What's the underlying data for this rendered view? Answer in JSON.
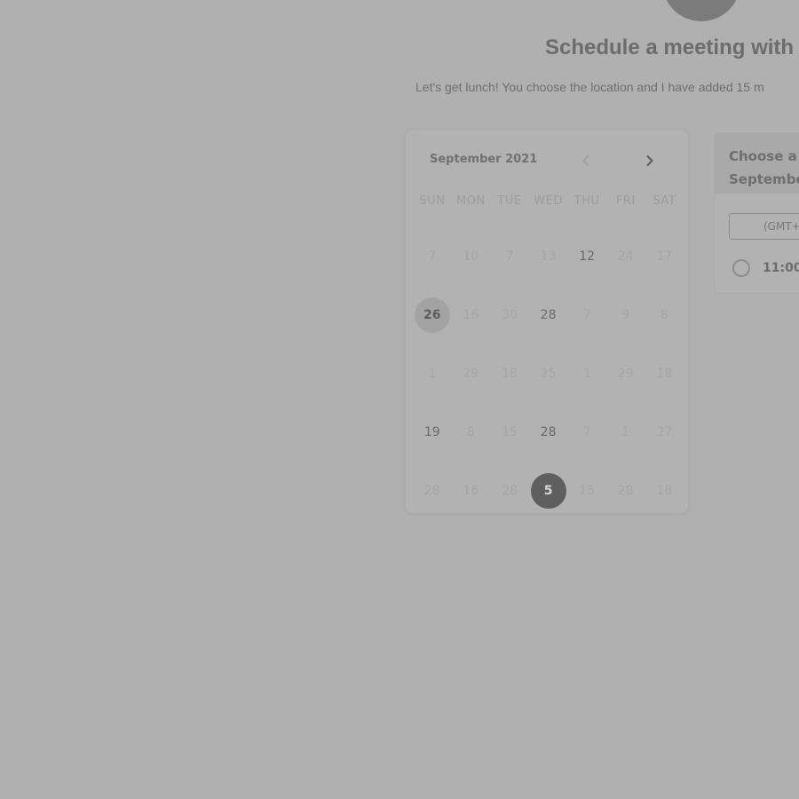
{
  "header": {
    "title": "Schedule a meeting with",
    "subtitle": "Let's get lunch! You choose the location and I have added 15 m"
  },
  "calendar": {
    "month_label": "September 2021",
    "prev_icon": "chevron-left-icon",
    "next_icon": "chevron-right-icon",
    "weekdays": [
      "SUN",
      "MON",
      "TUE",
      "WED",
      "THU",
      "FRI",
      "SAT"
    ],
    "weeks": [
      [
        {
          "label": "7",
          "state": "disabled"
        },
        {
          "label": "10",
          "state": "disabled"
        },
        {
          "label": "7",
          "state": "disabled"
        },
        {
          "label": "13",
          "state": "disabled"
        },
        {
          "label": "12",
          "state": "available"
        },
        {
          "label": "24",
          "state": "disabled"
        },
        {
          "label": "17",
          "state": "disabled"
        }
      ],
      [
        {
          "label": "26",
          "state": "today"
        },
        {
          "label": "16",
          "state": "disabled"
        },
        {
          "label": "30",
          "state": "disabled"
        },
        {
          "label": "28",
          "state": "available"
        },
        {
          "label": "7",
          "state": "disabled"
        },
        {
          "label": "9",
          "state": "disabled"
        },
        {
          "label": "8",
          "state": "disabled"
        }
      ],
      [
        {
          "label": "1",
          "state": "disabled"
        },
        {
          "label": "29",
          "state": "disabled"
        },
        {
          "label": "18",
          "state": "disabled"
        },
        {
          "label": "25",
          "state": "disabled"
        },
        {
          "label": "1",
          "state": "disabled"
        },
        {
          "label": "29",
          "state": "disabled"
        },
        {
          "label": "18",
          "state": "disabled"
        }
      ],
      [
        {
          "label": "19",
          "state": "available"
        },
        {
          "label": "8",
          "state": "disabled"
        },
        {
          "label": "15",
          "state": "disabled"
        },
        {
          "label": "28",
          "state": "available"
        },
        {
          "label": "7",
          "state": "disabled"
        },
        {
          "label": "1",
          "state": "disabled"
        },
        {
          "label": "27",
          "state": "disabled"
        }
      ],
      [
        {
          "label": "28",
          "state": "disabled"
        },
        {
          "label": "16",
          "state": "disabled"
        },
        {
          "label": "28",
          "state": "disabled"
        },
        {
          "label": "5",
          "state": "selected"
        },
        {
          "label": "15",
          "state": "disabled"
        },
        {
          "label": "28",
          "state": "disabled"
        },
        {
          "label": "18",
          "state": "disabled"
        }
      ]
    ]
  },
  "time_panel": {
    "header_line1": "Choose a t",
    "header_line2": "Septembe",
    "timezone": "(GMT+",
    "slot_label": "11:00"
  }
}
